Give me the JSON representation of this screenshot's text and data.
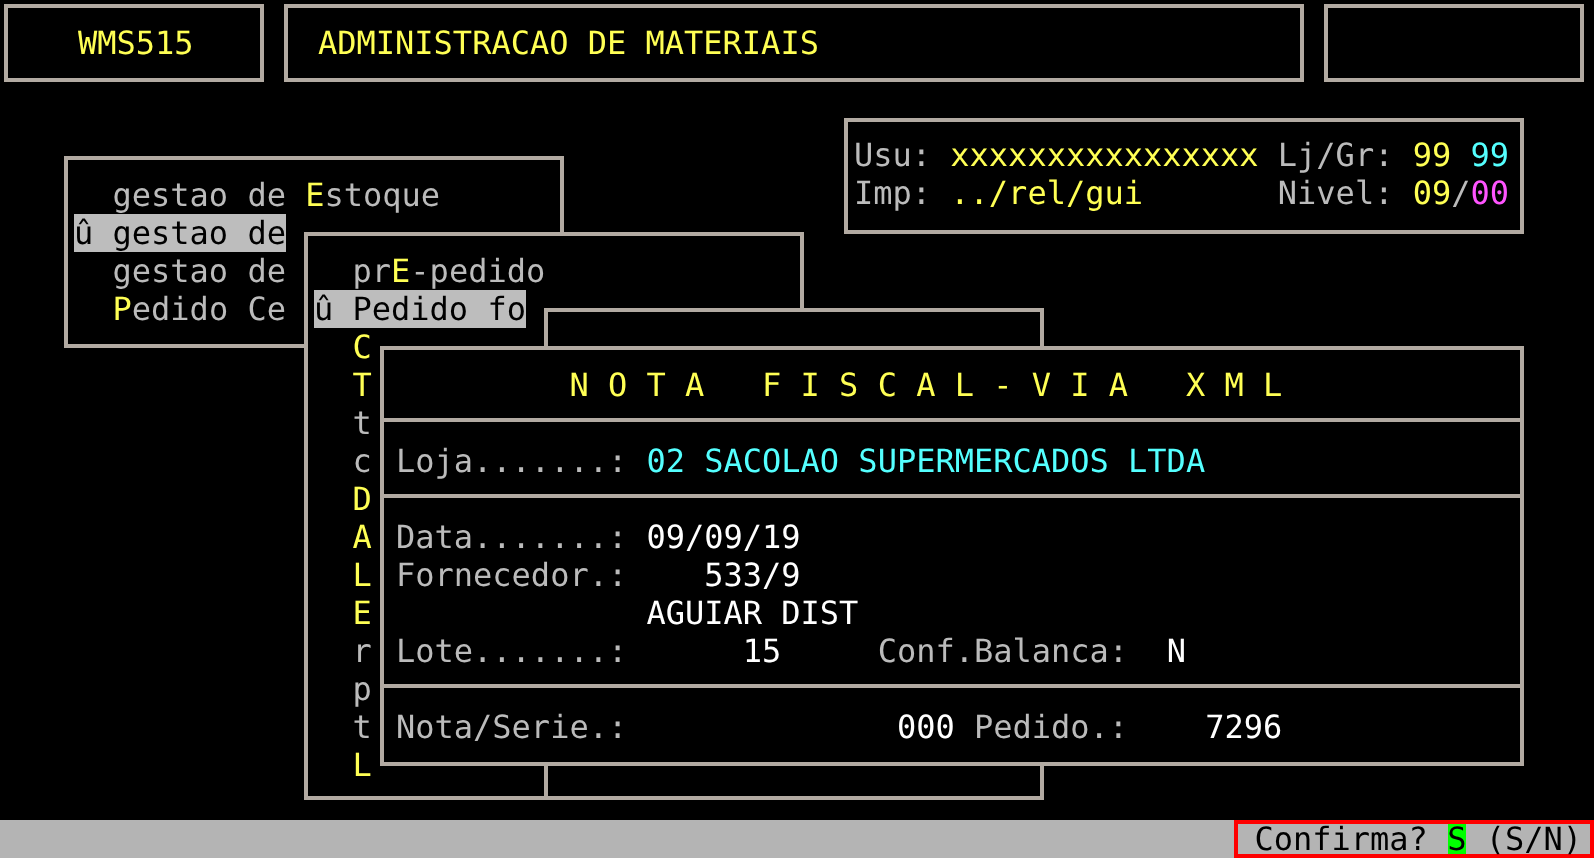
{
  "header": {
    "program_code": "WMS515",
    "title": "ADMINISTRACAO DE MATERIAIS"
  },
  "session": {
    "lines": [
      {
        "cells": [
          {
            "text": "Usu:"
          },
          {
            "text": "xxxxxxxxxxxxxxxx",
            "color": "#ffff54"
          },
          {
            "text": "Lj/Gr:"
          },
          {
            "text": "99",
            "color": "#ffff54"
          },
          {
            "text": "99",
            "color": "#54ffff"
          }
        ]
      },
      {
        "cells": [
          {
            "text": "Imp:"
          },
          {
            "text": "../rel/gui",
            "color": "#ffff54"
          },
          {
            "text": "Nivel:"
          },
          {
            "text": "09",
            "color": "#ffff54"
          },
          {
            "text": "/"
          },
          {
            "text": "00",
            "color": "#ff54ff"
          }
        ]
      }
    ]
  },
  "menus": [
    {
      "items": [
        {
          "before": "gestao de ",
          "hotkey": "E",
          "after": "stoque",
          "selected": false
        },
        {
          "marker": "û",
          "before": "gestao de",
          "selected": true
        },
        {
          "before": "gestao de",
          "selected": false
        },
        {
          "hotkey": "P",
          "after": "edido Ce",
          "selected": false
        }
      ]
    },
    {
      "items": [
        {
          "before": "pr",
          "hotkey": "E",
          "after": "-pedido",
          "selected": false
        },
        {
          "marker": "û",
          "before": "Pedido fo",
          "selected": true
        },
        {
          "hotkey": "C",
          "selected": false
        },
        {
          "hotkey": "T",
          "selected": false
        },
        {
          "before": "t",
          "selected": false
        },
        {
          "before": "c",
          "selected": false
        },
        {
          "hotkey": "D",
          "selected": false
        },
        {
          "hotkey": "A",
          "selected": false
        },
        {
          "hotkey": "L",
          "selected": false
        },
        {
          "hotkey": "E",
          "selected": false
        },
        {
          "before": "r",
          "selected": false
        },
        {
          "before": "p",
          "selected": false
        },
        {
          "before": "t",
          "selected": false
        },
        {
          "hotkey": "L",
          "selected": false
        }
      ]
    }
  ],
  "dialog": {
    "title": "N O T A   F I S C A L - V I A   X M L",
    "sections": [
      {
        "lines": [
          {
            "cells": [
              {
                "text": "Loja.......:"
              },
              {
                "text": "02 SACOLAO SUPERMERCADOS LTDA",
                "color": "#54ffff"
              }
            ]
          }
        ]
      },
      {
        "lines": [
          {
            "cells": [
              {
                "text": "Data.......:"
              },
              {
                "text": "09/09/19",
                "color": "#ffffff"
              }
            ]
          },
          {
            "cells": [
              {
                "text": "Fornecedor.:"
              },
              {
                "text": "533/9",
                "color": "#ffffff"
              }
            ]
          },
          {
            "cells": [
              {
                "text": "AGUIAR DIST",
                "color": "#ffffff"
              }
            ]
          },
          {
            "cells": [
              {
                "text": "Lote.......:"
              },
              {
                "text": "15",
                "color": "#ffffff"
              },
              {
                "text": "Conf.Balanca:"
              },
              {
                "text": "N",
                "color": "#ffffff"
              }
            ]
          }
        ]
      },
      {
        "lines": [
          {
            "cells": [
              {
                "text": "Nota/Serie.:"
              },
              {
                "text": "000",
                "color": "#ffffff"
              },
              {
                "text": "Pedido.:"
              },
              {
                "text": "7296",
                "color": "#ffffff"
              }
            ]
          }
        ]
      }
    ]
  },
  "status_bar": {
    "prompt": "Confirma?",
    "answer": "S",
    "options": "(S/N)"
  }
}
